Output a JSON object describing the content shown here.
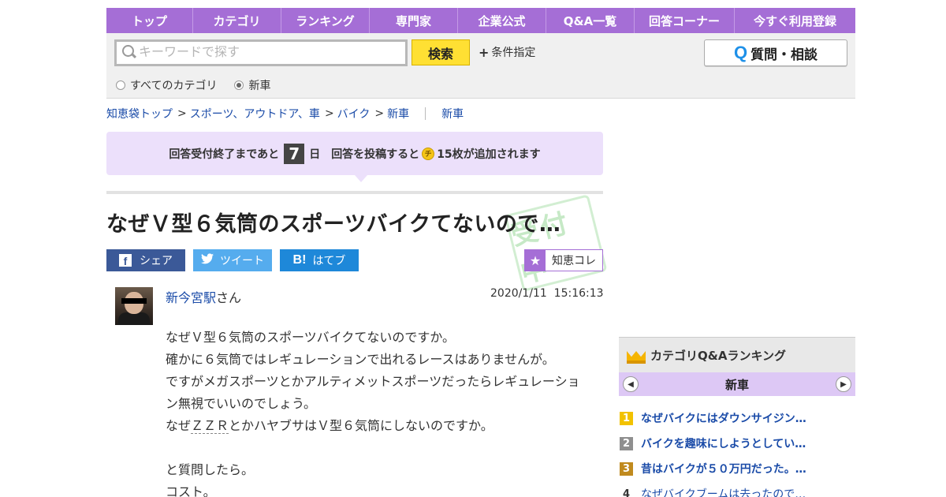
{
  "nav": {
    "items": [
      "トップ",
      "カテゴリ",
      "ランキング",
      "専門家",
      "企業公式",
      "Q&A一覧",
      "回答コーナー",
      "今すぐ利用登録"
    ]
  },
  "search": {
    "placeholder": "キーワードで探す",
    "button_label": "検索",
    "conditions_label": "条件指定",
    "ask_button_label": "質問・相談",
    "ask_icon": "Q",
    "scope_options": [
      {
        "label": "すべてのカテゴリ",
        "selected": false
      },
      {
        "label": "新車",
        "selected": true
      }
    ]
  },
  "breadcrumb": {
    "items": [
      "知恵袋トップ",
      "スポーツ、アウトドア、車",
      "バイク",
      "新車"
    ],
    "separator": ">",
    "current": "新車"
  },
  "notice": {
    "prefix": "回答受付終了まであと",
    "days": "7",
    "days_unit": "日",
    "reward_prefix": "回答を投稿すると",
    "coin_symbol": "チ",
    "reward_suffix": "15枚が追加されます"
  },
  "question": {
    "title": "なぜＶ型６気筒のスポーツバイクてないので…",
    "stamp": "受付中",
    "asker_name": "新今宮駅",
    "asker_suffix": "さん",
    "date": "2020/1/11  15:16:13",
    "body": [
      "なぜＶ型６気筒のスポーツバイクてないのですか。",
      "確かに６気筒ではレギュレーションで出れるレースはありませんが。",
      "ですがメガスポーツとかアルティメットスポーツだったらレギュレーショ",
      "ン無視でいいのでしょう。",
      {
        "before": "なぜ",
        "keyword": "ＺＺＲ",
        "after": "とかハヤブサはＶ型６気筒にしないのですか。"
      },
      "",
      "と質問したら。",
      "コスト。"
    ]
  },
  "share": {
    "facebook_label": "シェア",
    "twitter_label": "ツイート",
    "hatena_label": "はてブ",
    "hatena_icon": "B!",
    "collect_label": "知恵コレ"
  },
  "ranking": {
    "title": "カテゴリQ&Aランキング",
    "category": "新車",
    "items": [
      {
        "rank": "1",
        "text": "なぜバイクにはダウンサイジン…"
      },
      {
        "rank": "2",
        "text": "バイクを趣味にしようとしてい…"
      },
      {
        "rank": "3",
        "text": "昔はバイクが５０万円だった。…"
      },
      {
        "rank": "4",
        "text": "なぜバイクブームは去ったので…"
      }
    ]
  }
}
